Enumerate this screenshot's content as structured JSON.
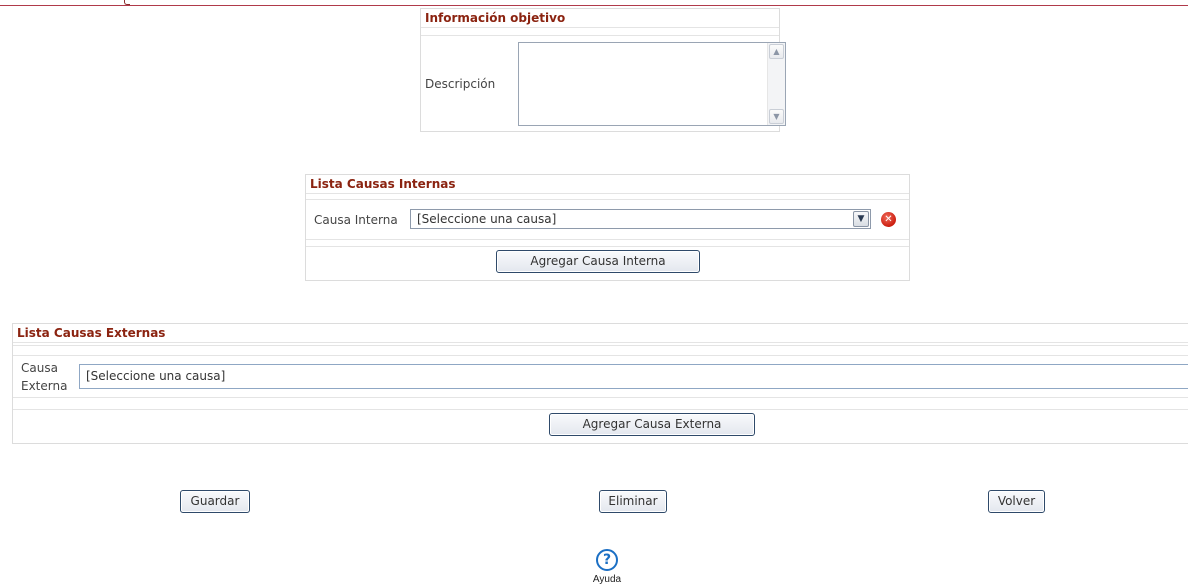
{
  "objective_panel": {
    "title": "Información objetivo",
    "description_label": "Descripción",
    "description_value": ""
  },
  "internal_causes": {
    "title": "Lista Causas Internas",
    "field_label": "Causa Interna",
    "selected": "[Seleccione una causa]",
    "add_button": "Agregar Causa Interna"
  },
  "external_causes": {
    "title": "Lista Causas Externas",
    "field_label_line1": "Causa",
    "field_label_line2": "Externa",
    "selected": "[Seleccione una causa]",
    "add_button": "Agregar Causa Externa"
  },
  "actions": {
    "save": "Guardar",
    "delete": "Eliminar",
    "back": "Volver"
  },
  "help": {
    "label": "Ayuda",
    "glyph": "?"
  },
  "colors": {
    "header_text": "#8b2310",
    "top_rule": "#b03a4a",
    "delete_icon": "#cc1f10",
    "help_icon": "#1b6fc4"
  },
  "icons": {
    "scroll_up": "scroll-up-icon",
    "scroll_down": "scroll-down-icon",
    "dropdown": "chevron-down-icon",
    "remove": "remove-icon",
    "help": "help-icon"
  }
}
